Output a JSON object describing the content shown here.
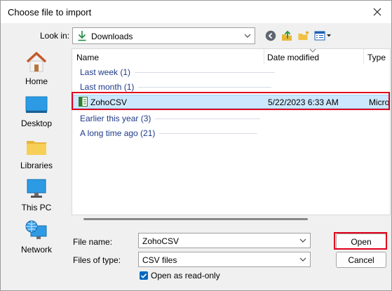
{
  "window": {
    "title": "Choose file to import"
  },
  "lookin": {
    "label": "Look in:",
    "value": "Downloads"
  },
  "places": [
    {
      "label": "Home",
      "icon": "home-icon"
    },
    {
      "label": "Desktop",
      "icon": "desktop-icon"
    },
    {
      "label": "Libraries",
      "icon": "libraries-icon"
    },
    {
      "label": "This PC",
      "icon": "this-pc-icon"
    },
    {
      "label": "Network",
      "icon": "network-icon"
    }
  ],
  "columns": {
    "name": "Name",
    "date": "Date modified",
    "type": "Type"
  },
  "groups": {
    "last_week": "Last week (1)",
    "last_month": "Last month (1)",
    "earlier_year": "Earlier this year (3)",
    "long_ago": "A long time ago (21)"
  },
  "selected_file": {
    "name": "ZohoCSV",
    "date": "5/22/2023 6:33 AM",
    "type": "Micro"
  },
  "fields": {
    "filename_label": "File name:",
    "filename_value": "ZohoCSV",
    "filetype_label": "Files of type:",
    "filetype_value": "CSV files",
    "readonly_label": "Open as read-only"
  },
  "buttons": {
    "open": "Open",
    "cancel": "Cancel"
  },
  "colors": {
    "accent": "#0067c0",
    "highlight": "#e0001b",
    "group_text": "#1e3a8a",
    "selection": "#cce8ff"
  }
}
